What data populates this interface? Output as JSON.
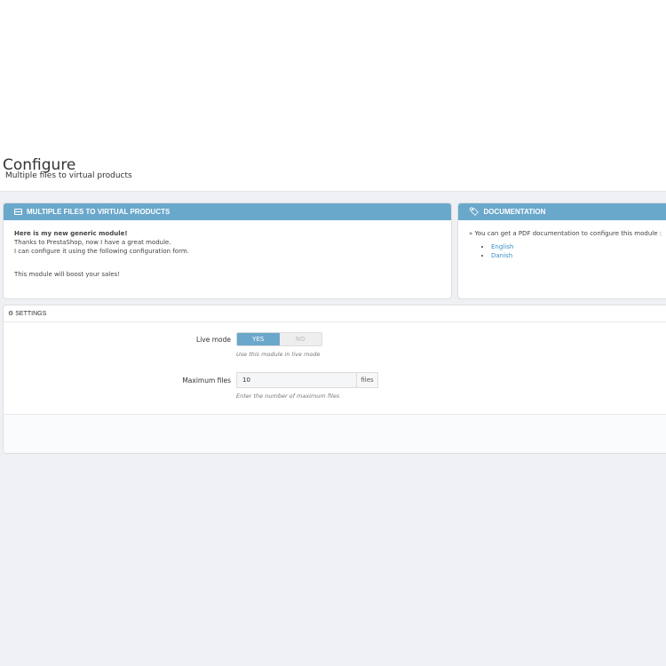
{
  "header": {
    "title": "Configure",
    "subtitle": "Multiple files to virtual products"
  },
  "module_panel": {
    "title": "MULTIPLE FILES TO VIRTUAL PRODUCTS",
    "intro": "Here is my new generic module!",
    "line1": "Thanks to PrestaShop, now I have a great module.",
    "line2": "I can configure it using the following configuration form.",
    "line3": "This module will boost your sales!"
  },
  "doc_panel": {
    "title": "DOCUMENTATION",
    "text": "» You can get a PDF documentation to configure this module :",
    "links": [
      "English",
      "Danish"
    ]
  },
  "settings": {
    "title": "SETTINGS",
    "live_mode_label": "Live mode",
    "yes": "YES",
    "no": "NO",
    "live_mode_help": "Use this module in live mode",
    "max_files_label": "Maximum files",
    "max_files_value": "10",
    "max_files_suffix": "files",
    "max_files_help": "Enter the number of maximum files"
  },
  "colors": {
    "accent": "#6aa8cb"
  }
}
